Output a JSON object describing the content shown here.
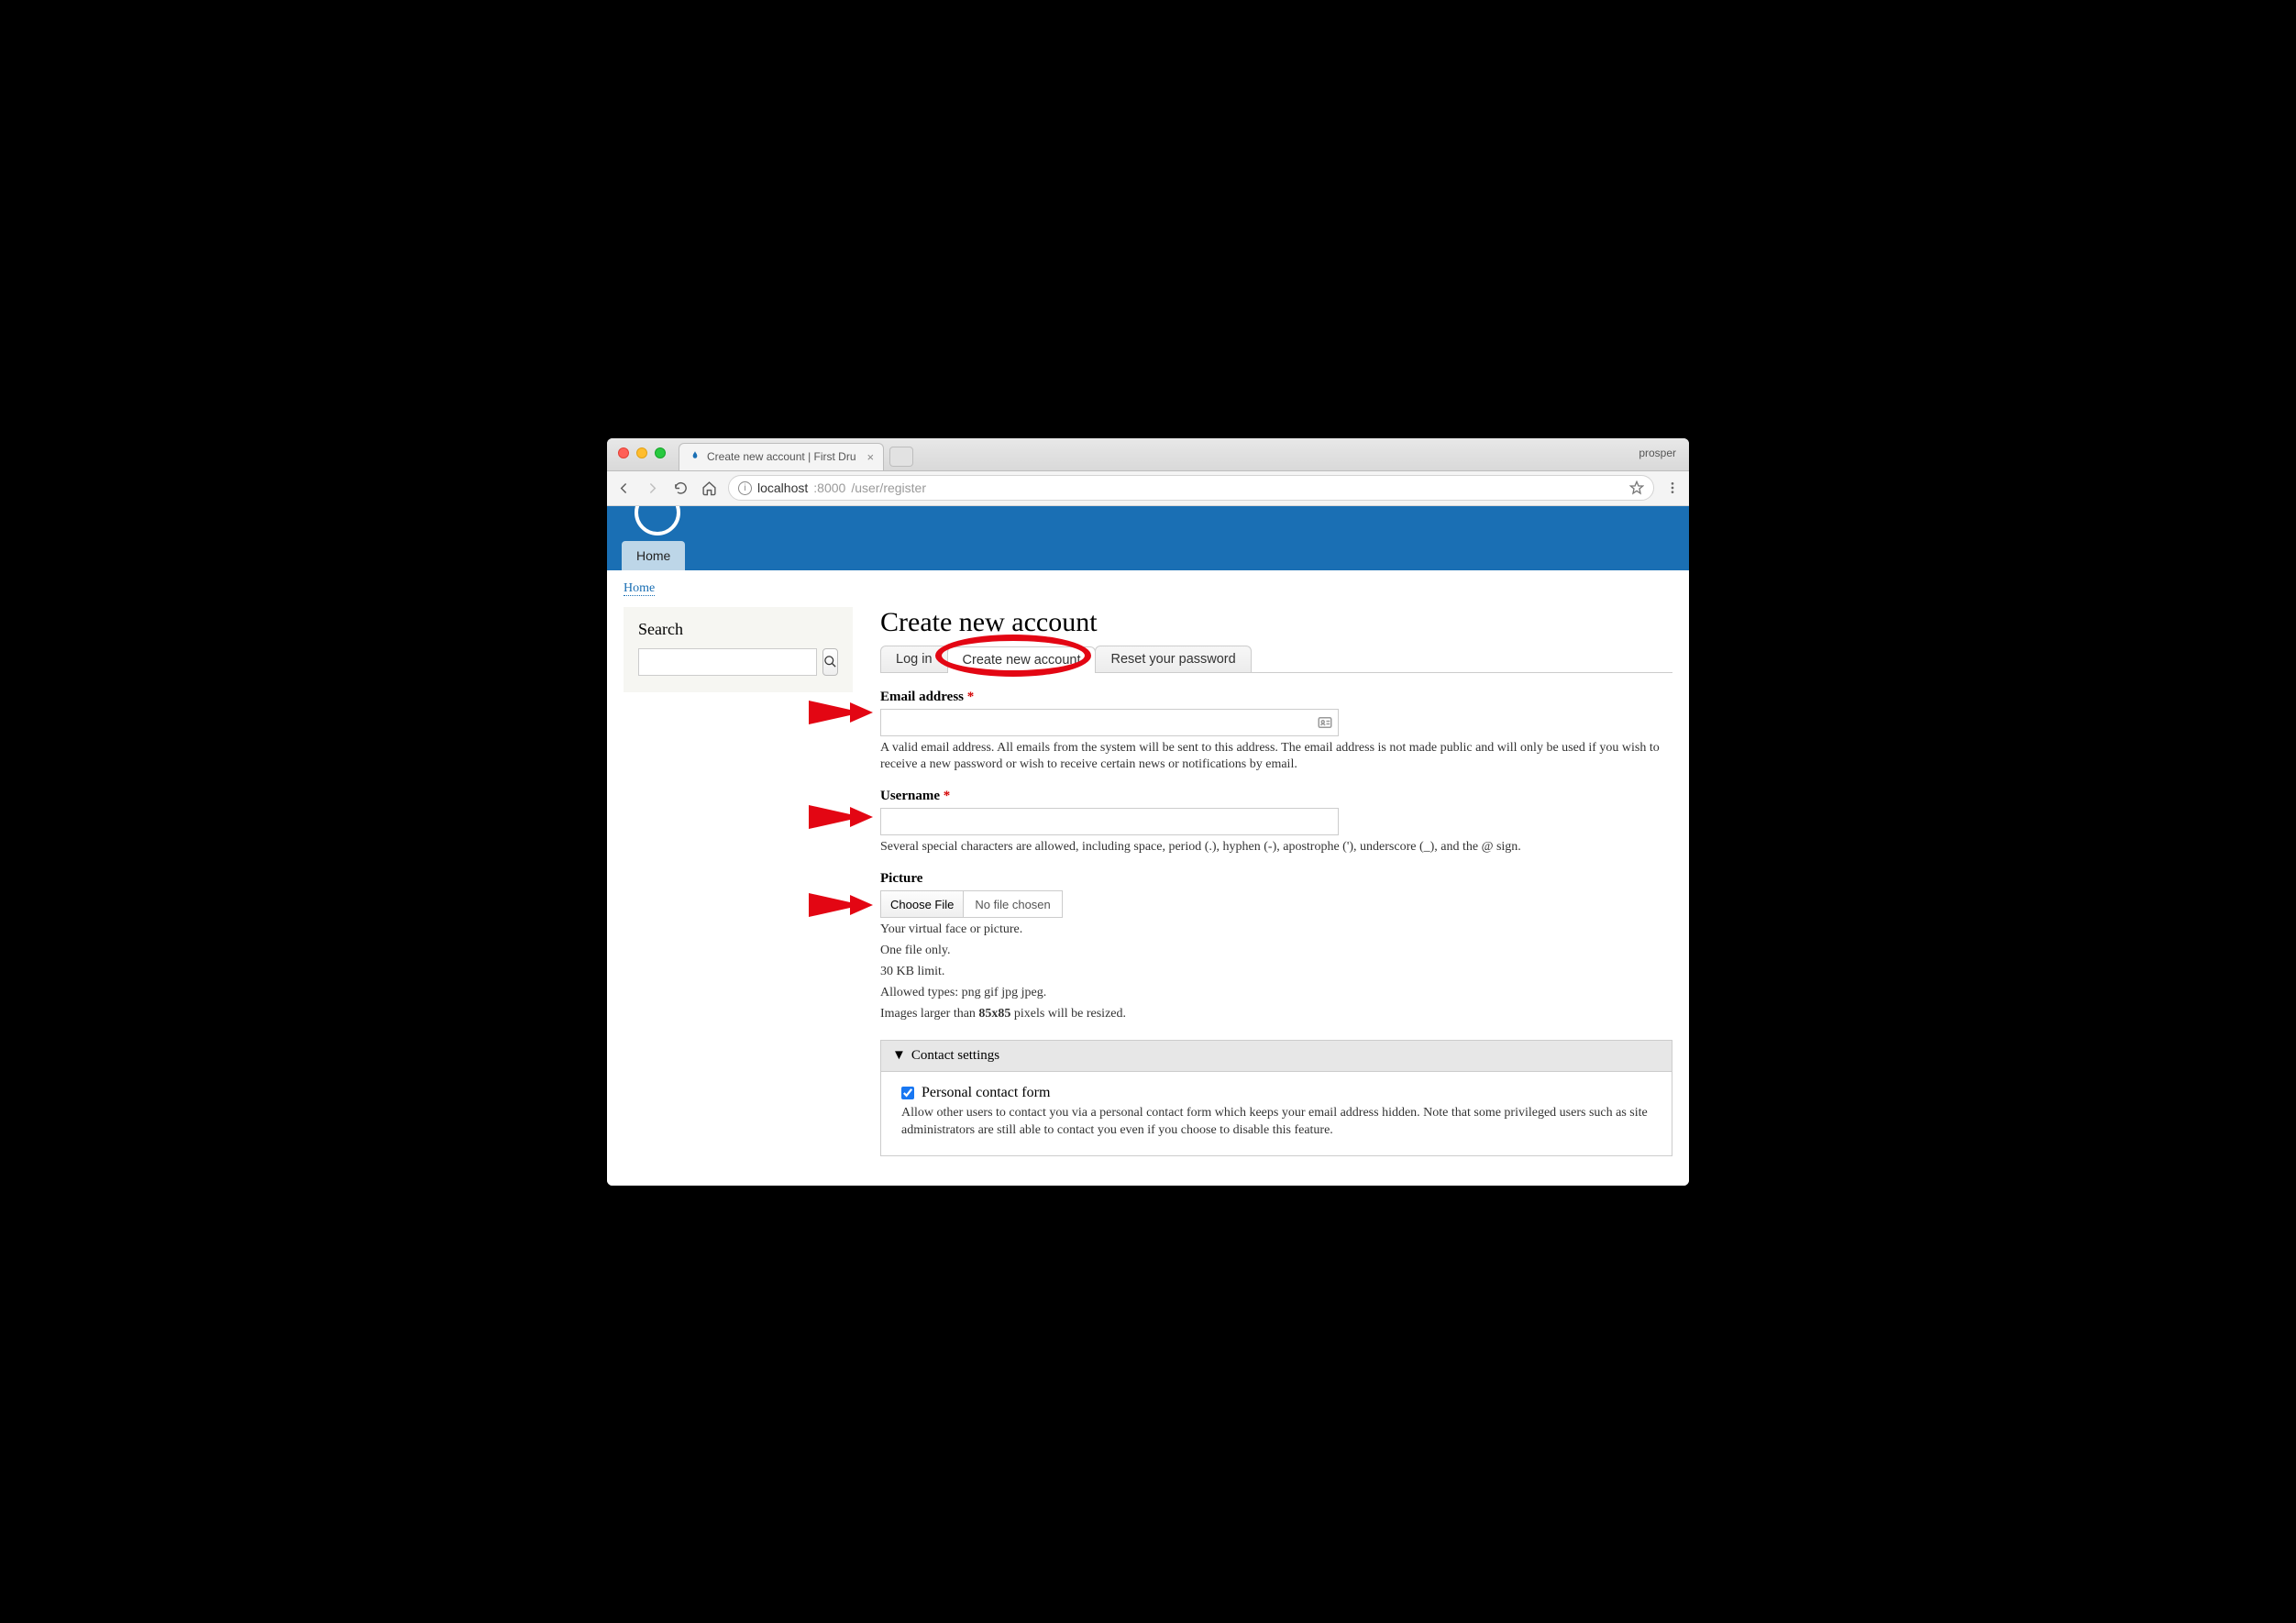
{
  "browser": {
    "tab_title": "Create new account | First Dru",
    "profile": "prosper",
    "url_host": "localhost",
    "url_port": ":8000",
    "url_path": "/user/register"
  },
  "nav": {
    "home": "Home"
  },
  "breadcrumb": {
    "home": "Home"
  },
  "search": {
    "heading": "Search"
  },
  "page": {
    "title": "Create new account"
  },
  "tabs": {
    "login": "Log in",
    "create": "Create new account",
    "reset": "Reset your password"
  },
  "form": {
    "email_label": "Email address",
    "email_desc": "A valid email address. All emails from the system will be sent to this address. The email address is not made public and will only be used if you wish to receive a new password or wish to receive certain news or notifications by email.",
    "username_label": "Username",
    "username_desc": "Several special characters are allowed, including space, period (.), hyphen (-), apostrophe ('), underscore (_), and the @ sign.",
    "picture_label": "Picture",
    "choose_file": "Choose File",
    "no_file": "No file chosen",
    "picture_desc1": "Your virtual face or picture.",
    "picture_desc2": "One file only.",
    "picture_desc3": "30 KB limit.",
    "picture_desc4": "Allowed types: png gif jpg jpeg.",
    "picture_desc5a": "Images larger than ",
    "picture_bold": "85x85",
    "picture_desc5b": " pixels will be resized.",
    "contact_legend": "Contact settings",
    "contact_chk": "Personal contact form",
    "contact_desc": "Allow other users to contact you via a personal contact form which keeps your email address hidden. Note that some privileged users such as site administrators are still able to contact you even if you choose to disable this feature."
  }
}
